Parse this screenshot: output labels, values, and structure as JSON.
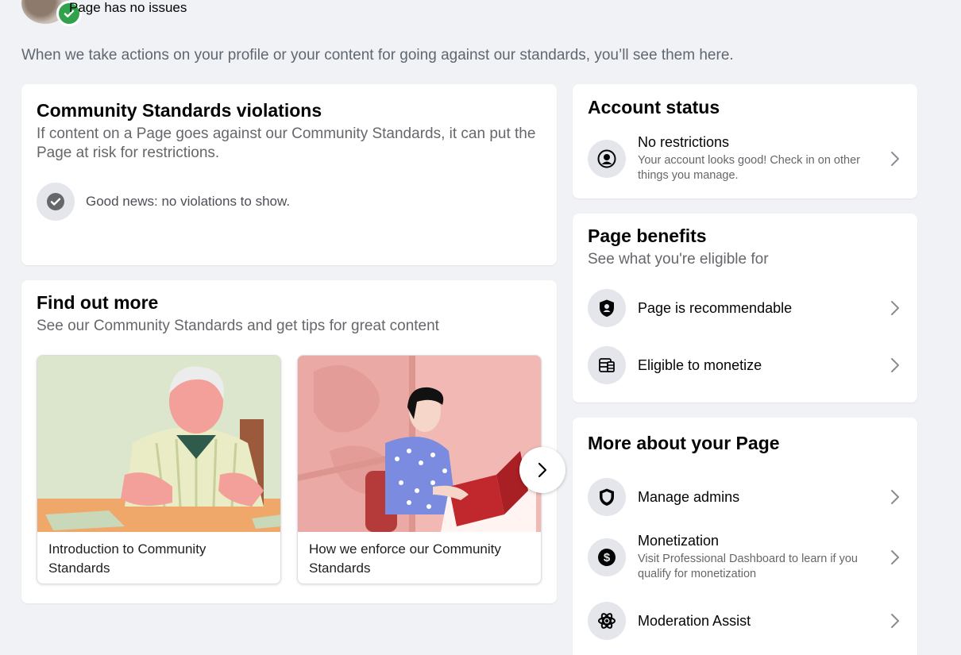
{
  "status": {
    "text": "Page has no issues"
  },
  "intro": "When we take actions on your profile or your content for going against our standards, you’ll see them here.",
  "violations": {
    "title": "Community Standards violations",
    "subtitle": "If content on a Page goes against our Community Standards, it can put the Page at risk for restrictions.",
    "good_news": "Good news: no violations to show."
  },
  "find_more": {
    "title": "Find out more",
    "subtitle": "See our Community Standards and get tips for great content",
    "articles": [
      {
        "label": "Introduction to Community Standards"
      },
      {
        "label": "How we enforce our Community Standards"
      }
    ]
  },
  "account_status": {
    "title": "Account status",
    "item": {
      "title": "No restrictions",
      "subtitle": "Your account looks good! Check in on other things you manage.",
      "icon": "user-circle-icon"
    }
  },
  "page_benefits": {
    "title": "Page benefits",
    "subtitle": "See what you're eligible for",
    "items": [
      {
        "title": "Page is recommendable",
        "icon": "shield-person-icon"
      },
      {
        "title": "Eligible to monetize",
        "icon": "money-stack-icon"
      }
    ]
  },
  "more_about": {
    "title": "More about your Page",
    "items": [
      {
        "title": "Manage admins",
        "icon": "shield-icon"
      },
      {
        "title": "Monetization",
        "subtitle": "Visit Professional Dashboard to learn if you qualify for monetization",
        "icon": "dollar-circle-icon"
      },
      {
        "title": "Moderation Assist",
        "icon": "atom-icon"
      }
    ]
  },
  "colors": {
    "success": "#31a24c",
    "icon_bg": "#e4e6eb",
    "page_bg": "#f0f2f5"
  }
}
